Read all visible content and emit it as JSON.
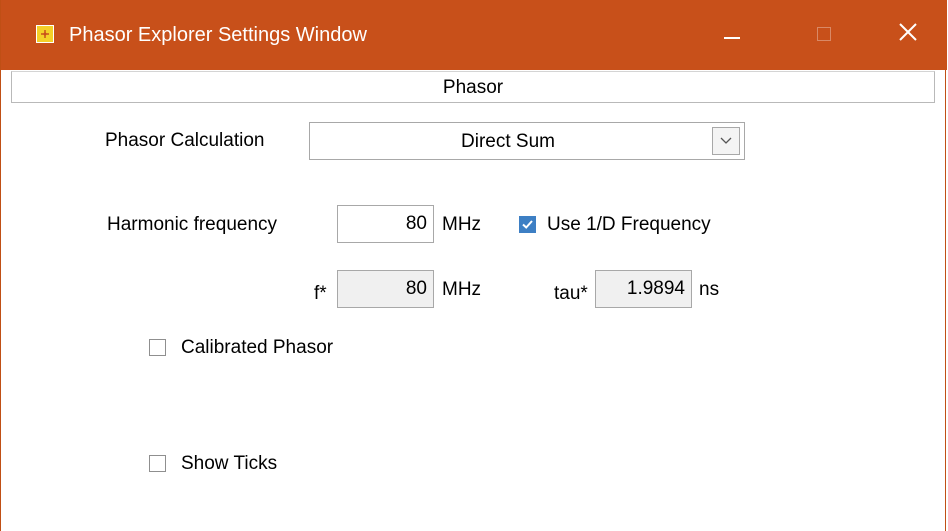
{
  "window": {
    "title": "Phasor Explorer Settings Window",
    "accent_color": "#c8501a"
  },
  "tabs": [
    {
      "label": "Phasor",
      "selected": true
    }
  ],
  "phasor_calculation": {
    "label": "Phasor Calculation",
    "selected": "Direct Sum"
  },
  "harmonic_frequency": {
    "label": "Harmonic frequency",
    "value": "80",
    "unit": "MHz"
  },
  "use_1d_frequency": {
    "label": "Use 1/D Frequency",
    "checked": true
  },
  "f_star": {
    "label": "f*",
    "value": "80",
    "unit": "MHz"
  },
  "tau_star": {
    "label": "tau*",
    "value": "1.9894",
    "unit": "ns"
  },
  "calibrated_phasor": {
    "label": "Calibrated Phasor",
    "checked": false
  },
  "show_ticks": {
    "label": "Show Ticks",
    "checked": false
  }
}
